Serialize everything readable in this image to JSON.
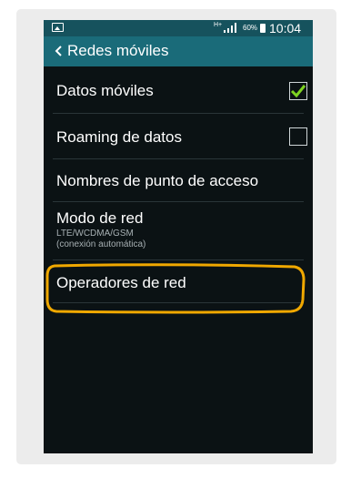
{
  "status_bar": {
    "network_type": "H+",
    "battery_percent": "60%",
    "time": "10:04"
  },
  "action_bar": {
    "title": "Redes móviles"
  },
  "settings": {
    "mobile_data": {
      "label": "Datos móviles",
      "checked": true
    },
    "data_roaming": {
      "label": "Roaming de datos",
      "checked": false
    },
    "access_point_names": {
      "label": "Nombres de punto de acceso"
    },
    "network_mode": {
      "label": "Modo de red",
      "value": "LTE/WCDMA/GSM",
      "value_note": "(conexión automática)"
    },
    "network_operators": {
      "label": "Operadores de red"
    }
  },
  "colors": {
    "status_bar": "#16525d",
    "action_bar": "#1a6b79",
    "background": "#0b1214",
    "check_green": "#7ed321",
    "highlight_orange": "#f0a800"
  }
}
